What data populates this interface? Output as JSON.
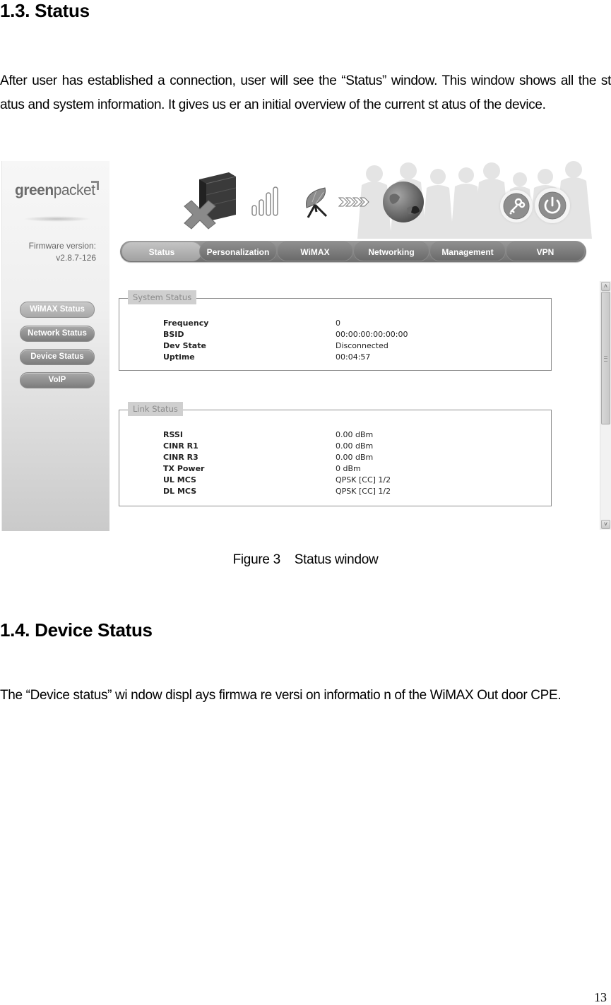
{
  "doc": {
    "section1_heading": "1.3. Status",
    "section1_paragraph": "After user has established a connection, user will see the “Status” window. This window shows all the st atus and system information. It gives us er an initial overview of the current st atus of the device.",
    "caption": "Figure 3    Status window",
    "section2_heading": "1.4. Device Status",
    "section2_paragraph": "The “Device  status” wi ndow displ ays firmwa re versi on informatio n of the WiMAX Out  door CPE.",
    "page_number": "13"
  },
  "app": {
    "logo_bold": "green",
    "logo_light": "packet",
    "firmware_label": "Firmware version:",
    "firmware_value": "v2.8.7-126",
    "header_icons": [
      "device-disconnected-icon",
      "signal-bars-icon",
      "satellite-dish-icon",
      "arrows-icon",
      "globe-icon",
      "key-icon",
      "power-icon"
    ],
    "nav_tabs": [
      {
        "label": "Status",
        "active": true
      },
      {
        "label": "Personalization",
        "active": false
      },
      {
        "label": "WiMAX",
        "active": false
      },
      {
        "label": "Networking",
        "active": false
      },
      {
        "label": "Management",
        "active": false
      },
      {
        "label": "VPN",
        "active": false
      }
    ],
    "side_buttons": [
      {
        "label": "WiMAX Status",
        "active": true
      },
      {
        "label": "Network Status",
        "active": false
      },
      {
        "label": "Device Status",
        "active": false
      },
      {
        "label": "VoIP",
        "active": false
      }
    ],
    "system_status": {
      "legend": "System Status",
      "rows": [
        {
          "key": "Frequency",
          "value": "0"
        },
        {
          "key": "BSID",
          "value": "00:00:00:00:00:00"
        },
        {
          "key": "Dev State",
          "value": "Disconnected"
        },
        {
          "key": "Uptime",
          "value": "00:04:57"
        }
      ]
    },
    "link_status": {
      "legend": "Link Status",
      "rows": [
        {
          "key": "RSSI",
          "value": "0.00 dBm"
        },
        {
          "key": "CINR R1",
          "value": "0.00 dBm"
        },
        {
          "key": "CINR R3",
          "value": "0.00 dBm"
        },
        {
          "key": "TX Power",
          "value": "0 dBm"
        },
        {
          "key": "UL MCS",
          "value": "QPSK [CC] 1/2"
        },
        {
          "key": "DL MCS",
          "value": "QPSK [CC] 1/2"
        }
      ]
    },
    "scrollbar": {
      "up_glyph": "˄",
      "down_glyph": "˅"
    }
  }
}
